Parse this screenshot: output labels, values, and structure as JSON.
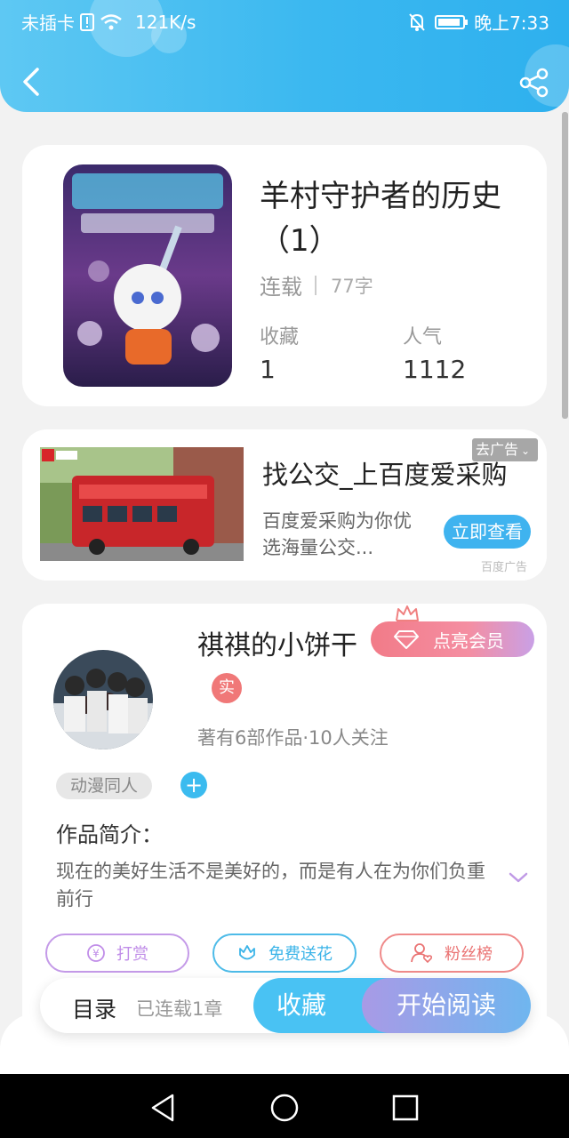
{
  "status_bar": {
    "carrier": "未插卡",
    "speed": "121K/s",
    "time": "晚上7:33"
  },
  "header": {
    "back_icon": "chevron-left-icon",
    "share_icon": "share-icon"
  },
  "book": {
    "title": "羊村守护者的历史（1）",
    "status": "连载",
    "word_count": "77字",
    "favorites_label": "收藏",
    "favorites_value": "1",
    "popularity_label": "人气",
    "popularity_value": "1112"
  },
  "ad": {
    "title": "找公交_上百度爱采购",
    "description": "百度爱采购为你优选海量公交...",
    "button": "立即查看",
    "tag": "去广告",
    "source": "百度广告"
  },
  "author": {
    "name": "祺祺的小饼干",
    "vip_button": "点亮会员",
    "real_badge": "实",
    "stats": "著有6部作品·10人关注",
    "tag": "动漫同人",
    "intro_label": "作品简介：",
    "intro_text": "现在的美好生活不是美好的，而是有人在为你们负重前行",
    "actions": {
      "tip": "打赏",
      "flower": "免费送花",
      "fans": "粉丝榜"
    }
  },
  "bottom_bar": {
    "toc": "目录",
    "chapters": "已连载1章",
    "collect": "收藏",
    "read": "开始阅读"
  },
  "colors": {
    "accent": "#3bb8f0",
    "vip": "#f27b88",
    "tip": "#c49ae8",
    "fans": "#ef8a8a"
  }
}
